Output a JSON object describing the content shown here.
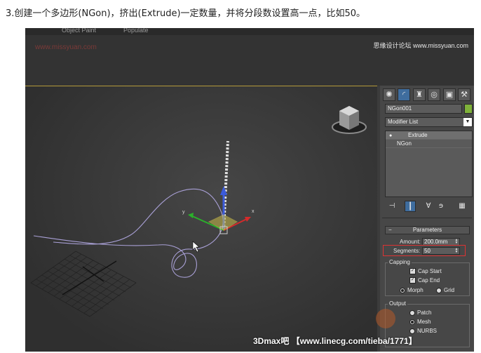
{
  "caption": "3.创建一个多边形(NGon)，挤出(Extrude)一定数量，并将分段数设置高一点，比如50。",
  "menu": [
    "Object Paint",
    "Populate"
  ],
  "watermarks": {
    "top_left_red": "www.missyuan.com",
    "top_right": "思缘设计论坛 www.missyuan.com",
    "bottom": "3Dmax吧 【www.linecg.com/tieba/1771】"
  },
  "panel": {
    "tabs": [
      {
        "icon": "sun-icon",
        "glyph": "✺",
        "active": false
      },
      {
        "icon": "arc-icon",
        "glyph": "◜",
        "active": true
      },
      {
        "icon": "hierarchy-icon",
        "glyph": "♜",
        "active": false
      },
      {
        "icon": "motion-icon",
        "glyph": "◎",
        "active": false
      },
      {
        "icon": "display-icon",
        "glyph": "▣",
        "active": false
      },
      {
        "icon": "hammer-icon",
        "glyph": "⚒",
        "active": false
      }
    ],
    "object_name": "NGon001",
    "object_color": "#7fb23a",
    "modifier_list_label": "Modifier List",
    "stack": [
      {
        "label": "Extrude",
        "selected": true
      },
      {
        "label": "NGon",
        "selected": false
      }
    ],
    "stack_tools": [
      "pin-icon",
      "show-end-icon",
      "unique-icon",
      "remove-modifier-icon",
      "configure-icon"
    ],
    "parameters_title": "Parameters",
    "amount_label": "Amount:",
    "amount_value": "200.0mm",
    "segments_label": "Segments:",
    "segments_value": "50",
    "capping_title": "Capping",
    "cap_start": "Cap Start",
    "cap_end": "Cap End",
    "morph": "Morph",
    "grid": "Grid",
    "output_title": "Output",
    "patch": "Patch",
    "mesh": "Mesh",
    "nurbs": "NURBS"
  },
  "colors": {
    "accent_blue": "#3f6d9e",
    "highlight_red": "#d33333",
    "viewport_border": "#b49a3a"
  }
}
